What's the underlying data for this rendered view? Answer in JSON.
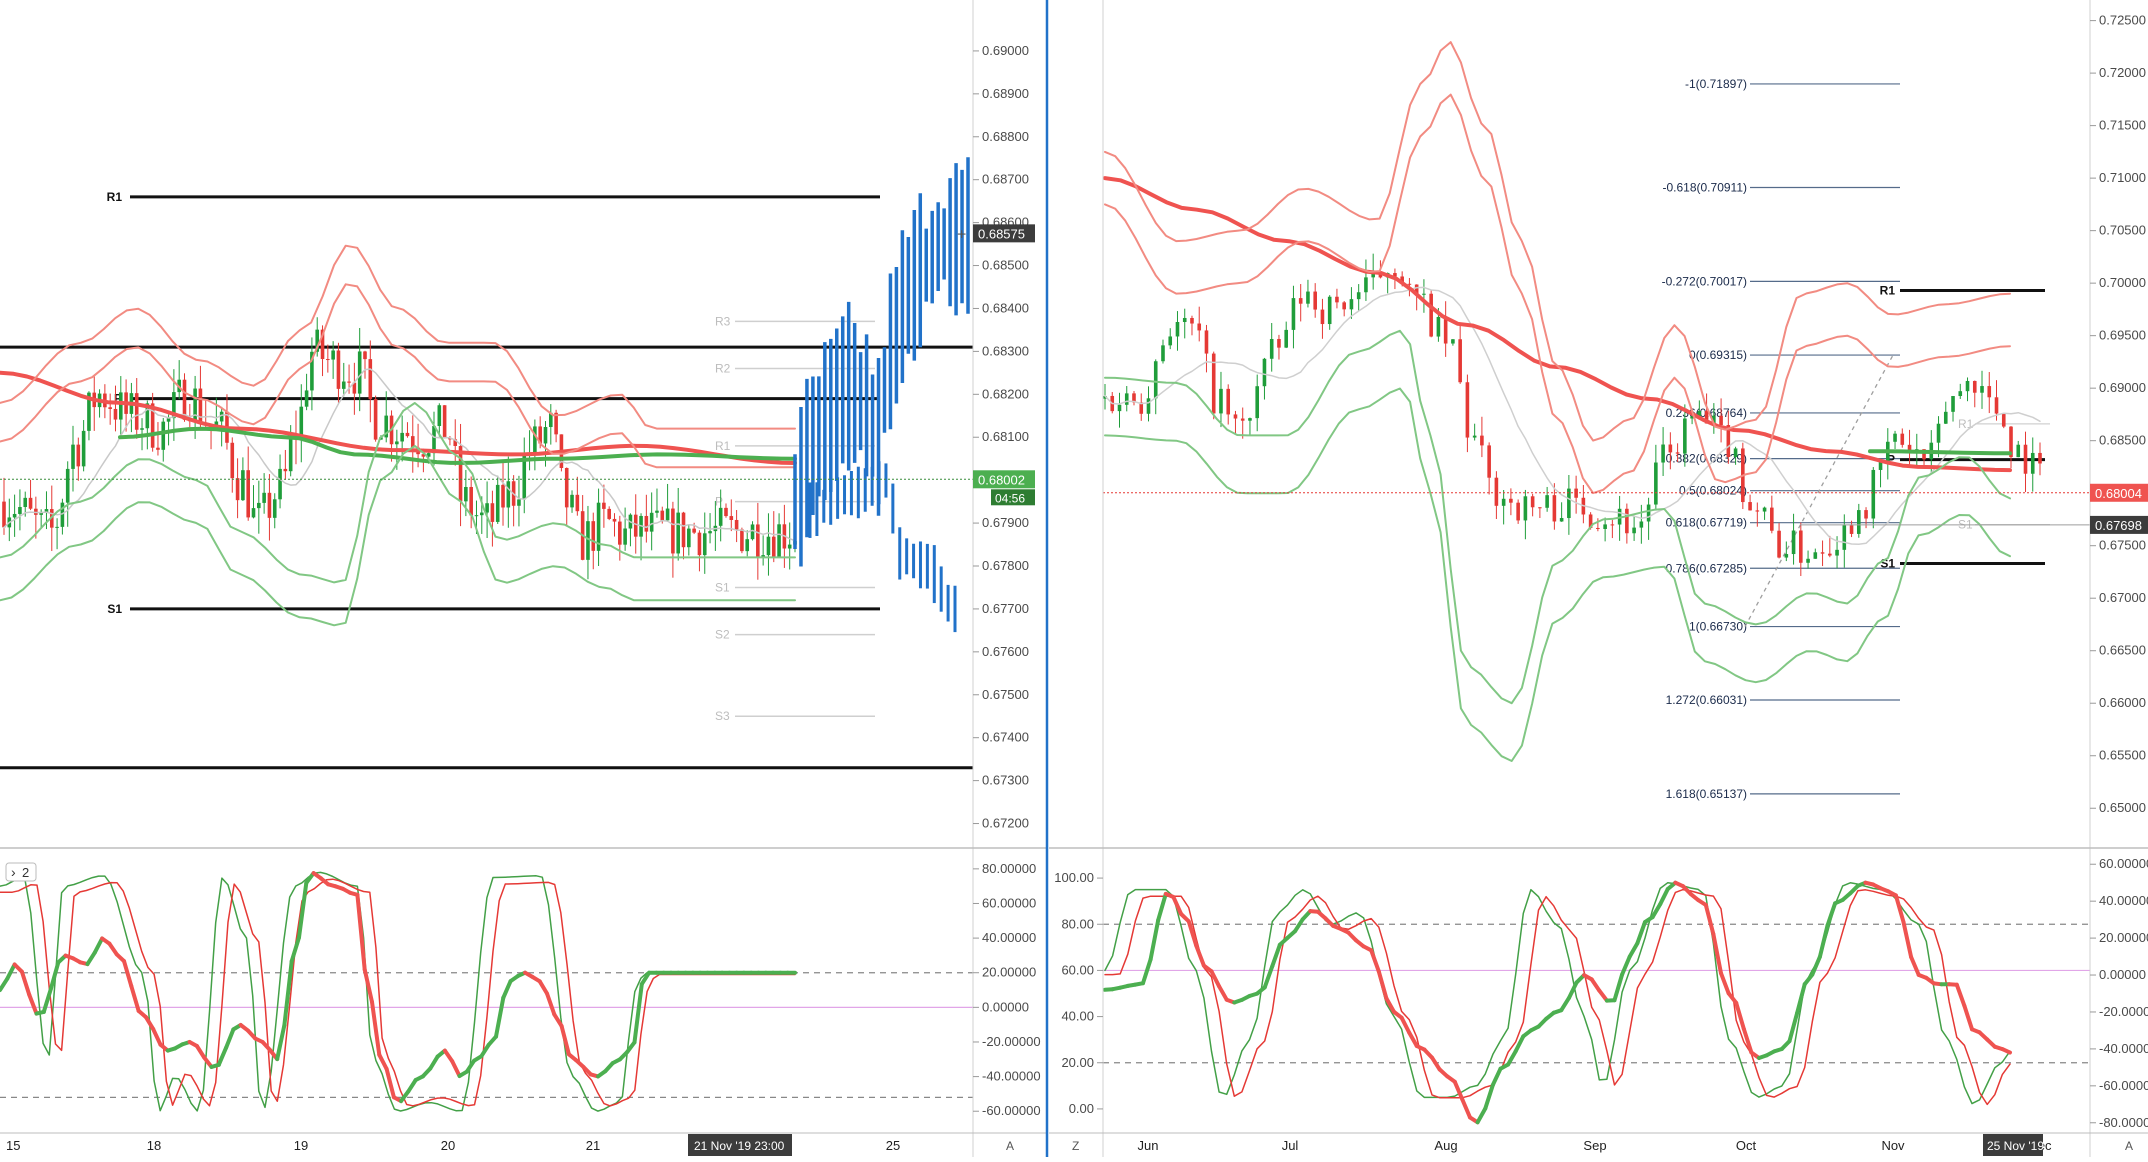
{
  "theme": {
    "red": "#ef5350",
    "green": "#4caf50",
    "blue": "#2172c9",
    "black": "#111111",
    "grey": "#bdbdbd"
  },
  "left": {
    "pane_badge": "2",
    "yticks": [
      "0.69000",
      "0.68900",
      "0.68800",
      "0.68700",
      "0.68600",
      "0.68500",
      "0.68400",
      "0.68300",
      "0.68200",
      "0.68100",
      "0.67900",
      "0.67800",
      "0.67700",
      "0.67600",
      "0.67500",
      "0.67400",
      "0.67300",
      "0.67200"
    ],
    "ylim": [
      0.6715,
      0.691
    ],
    "xticks": [
      "15",
      "18",
      "19",
      "20",
      "21",
      "25"
    ],
    "crosshair_date": "21 Nov '19  23:00",
    "price_tags": {
      "top": "0.68575",
      "current": "0.68002",
      "timer": "04:56"
    },
    "pivots": [
      {
        "label": "R1",
        "value": 0.6866,
        "style": "solid"
      },
      {
        "label": "P",
        "value": 0.6819,
        "style": "solid"
      },
      {
        "label": "S1",
        "value": 0.677,
        "style": "solid"
      },
      {
        "label": "",
        "value": 0.6831,
        "style": "solid"
      },
      {
        "label": "",
        "value": 0.6733,
        "style": "solid"
      },
      {
        "label": "R3",
        "value": 0.6837,
        "style": "faint"
      },
      {
        "label": "R2",
        "value": 0.6826,
        "style": "faint"
      },
      {
        "label": "R1",
        "value": 0.6808,
        "style": "faint"
      },
      {
        "label": "P",
        "value": 0.6795,
        "style": "faint"
      },
      {
        "label": "S1",
        "value": 0.6775,
        "style": "faint"
      },
      {
        "label": "S2",
        "value": 0.6764,
        "style": "faint"
      },
      {
        "label": "S3",
        "value": 0.6745,
        "style": "faint"
      }
    ],
    "osc_yticks": [
      "80.00000",
      "60.00000",
      "40.00000",
      "20.00000",
      "0.00000",
      "-20.00000",
      "-40.00000",
      "-60.00000"
    ],
    "osc_ylim": [
      -72,
      88
    ]
  },
  "right": {
    "yticks": [
      "0.72500",
      "0.72000",
      "0.71500",
      "0.71000",
      "0.70500",
      "0.70000",
      "0.69500",
      "0.69000",
      "0.68500",
      "0.68000",
      "0.67500",
      "0.67000",
      "0.66500",
      "0.66000",
      "0.65500",
      "0.65000"
    ],
    "ylim": [
      0.6465,
      0.7262
    ],
    "xticks": [
      "Jun",
      "Jul",
      "Aug",
      "Sep",
      "Oct",
      "Nov",
      "Dec"
    ],
    "crosshair_date": "25 Nov '19",
    "price_tags": {
      "current": "0.68004",
      "marker": "0.67698"
    },
    "fib_labels": [
      {
        "label": "-1(0.71897)",
        "value": 0.71897
      },
      {
        "label": "-0.618(0.70911)",
        "value": 0.70911
      },
      {
        "label": "-0.272(0.70017)",
        "value": 0.70017
      },
      {
        "label": "0(0.69315)",
        "value": 0.69315
      },
      {
        "label": "0.236(0.68764)",
        "value": 0.68764
      },
      {
        "label": "0.382(0.68329)",
        "value": 0.68329
      },
      {
        "label": "0.5(0.68024)",
        "value": 0.68024
      },
      {
        "label": "0.618(0.67719)",
        "value": 0.67719
      },
      {
        "label": "0.786(0.67285)",
        "value": 0.67285
      },
      {
        "label": "1(0.66730)",
        "value": 0.6673
      },
      {
        "label": "1.272(0.66031)",
        "value": 0.66031
      },
      {
        "label": "1.618(0.65137)",
        "value": 0.65137
      }
    ],
    "pivots": [
      {
        "label": "R1",
        "value": 0.6993
      },
      {
        "label": "P",
        "value": 0.6832
      },
      {
        "label": "S1",
        "value": 0.6733
      }
    ],
    "faint_pivots": [
      {
        "label": "R1",
        "value": 0.6866
      },
      {
        "label": "S1",
        "value": 0.677
      }
    ],
    "osc_left_yticks": [
      "100.00",
      "80.00",
      "60.00",
      "40.00",
      "20.00",
      "0.00"
    ],
    "osc_left_ylim": [
      -10,
      110
    ],
    "osc_right_yticks": [
      "60.00000",
      "40.00000",
      "20.00000",
      "0.00000",
      "-20.00000",
      "-40.00000",
      "-60.00000",
      "-80.00000"
    ],
    "osc_right_ylim": [
      -85,
      65
    ]
  },
  "bottom": {
    "left_corner": "A",
    "right_left_corner": "Z",
    "right_corner": "A"
  },
  "chart_data": [
    {
      "type": "candlestick",
      "title": "",
      "series_note": "",
      "ylim": [
        0.6715,
        0.691
      ],
      "x": [
        "15",
        "18",
        "19",
        "20",
        "21",
        "25"
      ]
    },
    {
      "type": "candlestick",
      "title": "",
      "ylim": [
        0.6465,
        0.7262
      ],
      "x": [
        "Jun",
        "Jul",
        "Aug",
        "Sep",
        "Oct",
        "Nov",
        "Dec"
      ]
    }
  ]
}
